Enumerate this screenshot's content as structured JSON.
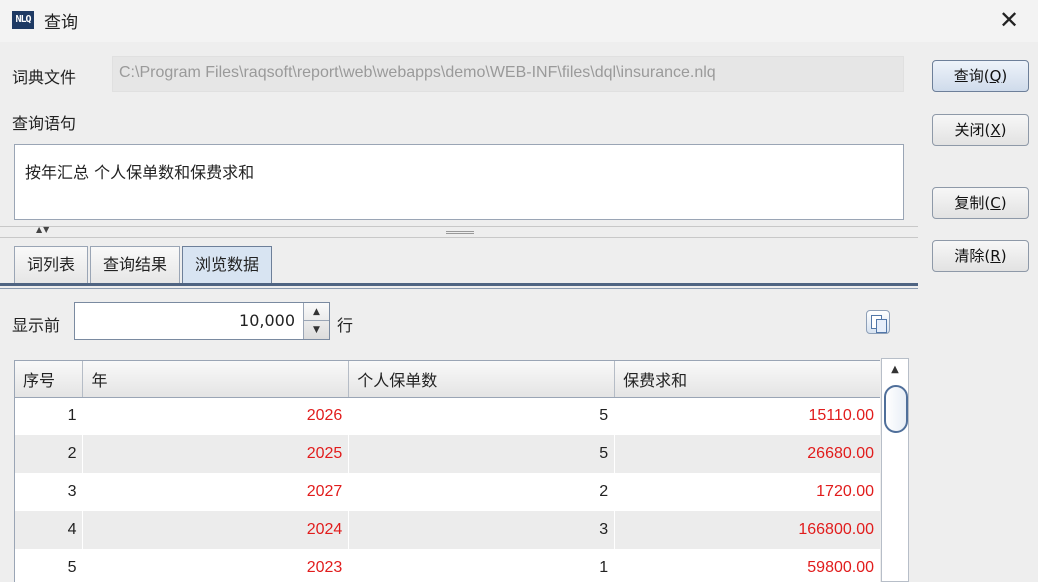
{
  "window": {
    "title": "查询",
    "app_badge": "NLQ"
  },
  "dict_file": {
    "label": "词典文件",
    "value": "C:\\Program Files\\raqsoft\\report\\web\\webapps\\demo\\WEB-INF\\files\\dql\\insurance.nlq"
  },
  "query": {
    "label": "查询语句",
    "text": "按年汇总 个人保单数和保费求和"
  },
  "buttons": {
    "query": {
      "text": "查询(",
      "key": "Q",
      "end": ")"
    },
    "close": {
      "text": "关闭(",
      "key": "X",
      "end": ")"
    },
    "copy": {
      "text": "复制(",
      "key": "C",
      "end": ")"
    },
    "clear": {
      "text": "清除(",
      "key": "R",
      "end": ")"
    }
  },
  "tabs": [
    {
      "label": "词列表"
    },
    {
      "label": "查询结果"
    },
    {
      "label": "浏览数据"
    }
  ],
  "browse": {
    "show_label": "显示前",
    "rows_value": "10,000",
    "rows_suffix": "行"
  },
  "table": {
    "headers": [
      "序号",
      "年",
      "个人保单数",
      "保费求和"
    ],
    "rows": [
      [
        "1",
        "2026",
        "5",
        "15110.00"
      ],
      [
        "2",
        "2025",
        "5",
        "26680.00"
      ],
      [
        "3",
        "2027",
        "2",
        "1720.00"
      ],
      [
        "4",
        "2024",
        "3",
        "166800.00"
      ],
      [
        "5",
        "2023",
        "1",
        "59800.00"
      ]
    ]
  },
  "colors": {
    "accent": "#4f6482",
    "value_red": "#e11c1c"
  }
}
